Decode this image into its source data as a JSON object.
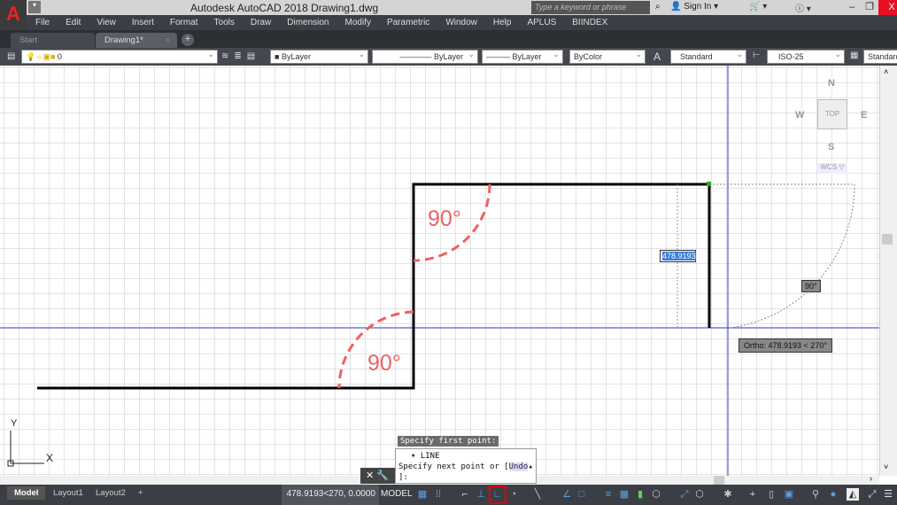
{
  "titlebar": {
    "app_title": "Autodesk AutoCAD 2018    Drawing1.dwg",
    "search_placeholder": "Type a keyword or phrase",
    "sign_in": "Sign In",
    "minimize": "–",
    "maximize": "❐",
    "close": "X"
  },
  "menu": [
    "File",
    "Edit",
    "View",
    "Insert",
    "Format",
    "Tools",
    "Draw",
    "Dimension",
    "Modify",
    "Parametric",
    "Window",
    "Help",
    "APLUS",
    "BIINDEX"
  ],
  "doc_tabs": {
    "start": "Start",
    "active": "Drawing1*",
    "add": "+"
  },
  "properties": {
    "layer": "0",
    "color": "ByLayer",
    "linetype": "ByLayer",
    "lineweight": "ByLayer",
    "plotstyle": "ByColor",
    "text_style": "Standard",
    "dim_style": "ISO-25",
    "table_style": "Standard"
  },
  "viewcube": {
    "n": "N",
    "s": "S",
    "e": "E",
    "w": "W",
    "top": "TOP",
    "wcs": "WCS ▽"
  },
  "drawing": {
    "angle_label_1": "90°",
    "angle_label_2": "90°",
    "line_color": "#000000",
    "annotation_color": "#f06060",
    "crosshair_color": "#3333cc"
  },
  "tooltips": {
    "dynamic_input": "478.9193",
    "angle": "90°",
    "ortho": "Ortho: 478.9193 < 270°"
  },
  "ucs": {
    "x": "X",
    "y": "Y"
  },
  "command": {
    "prompt_history": "Specify first point:",
    "command_name": "LINE",
    "current_prompt": "Specify next point or [",
    "undo_option": "Undo",
    "prompt_end": "]:"
  },
  "status": {
    "layout_tabs": [
      "Model",
      "Layout1",
      "Layout2"
    ],
    "add": "+",
    "coordinates": "478.9193<270, 0.0000",
    "space": "MODEL",
    "ortho_highlight_color": "#e00000"
  }
}
